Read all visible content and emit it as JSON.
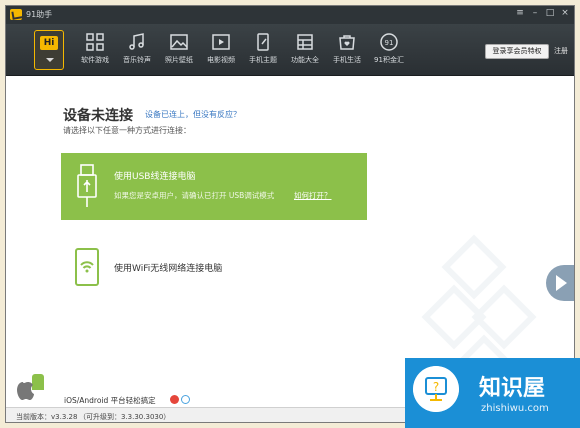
{
  "titlebar": {
    "title": "91助手"
  },
  "toolbar": {
    "hi_label": "Hi",
    "nav": [
      {
        "label": "软件游戏",
        "icon": "apps-grid-icon"
      },
      {
        "label": "音乐铃声",
        "icon": "music-note-icon"
      },
      {
        "label": "照片壁纸",
        "icon": "photo-icon"
      },
      {
        "label": "电影视频",
        "icon": "video-icon"
      },
      {
        "label": "手机主题",
        "icon": "phone-theme-icon"
      },
      {
        "label": "功能大全",
        "icon": "toolbox-icon"
      },
      {
        "label": "手机生活",
        "icon": "heart-bag-icon"
      },
      {
        "label": "91积金汇",
        "icon": "money-icon"
      }
    ],
    "vip_button": "登录享会员特权",
    "register": "注册"
  },
  "main": {
    "heading": "设备未连接",
    "heading_link": "设备已连上，但没有反应？",
    "subheading": "请选择以下任意一种方式进行连接：",
    "usb": {
      "title": "使用USB线连接电脑",
      "desc": "如果您是安卓用户，请确认已打开 USB调试模式",
      "link": "如何打开？"
    },
    "wifi": {
      "title": "使用WiFi无线网络连接电脑"
    }
  },
  "footer": {
    "platform_text": "iOS/Android 平台轻松搞定",
    "version": "当前版本：v3.3.28",
    "upgrade": "（可升级到：3.3.30.3030）"
  },
  "watermark": {
    "name": "知识屋",
    "url": "zhishiwu.com"
  },
  "colors": {
    "accent": "#f5b800",
    "usb_card": "#8cc04a",
    "toolbar": "#2e3438",
    "link": "#3a78c2",
    "watermark": "#1b8fd6"
  }
}
